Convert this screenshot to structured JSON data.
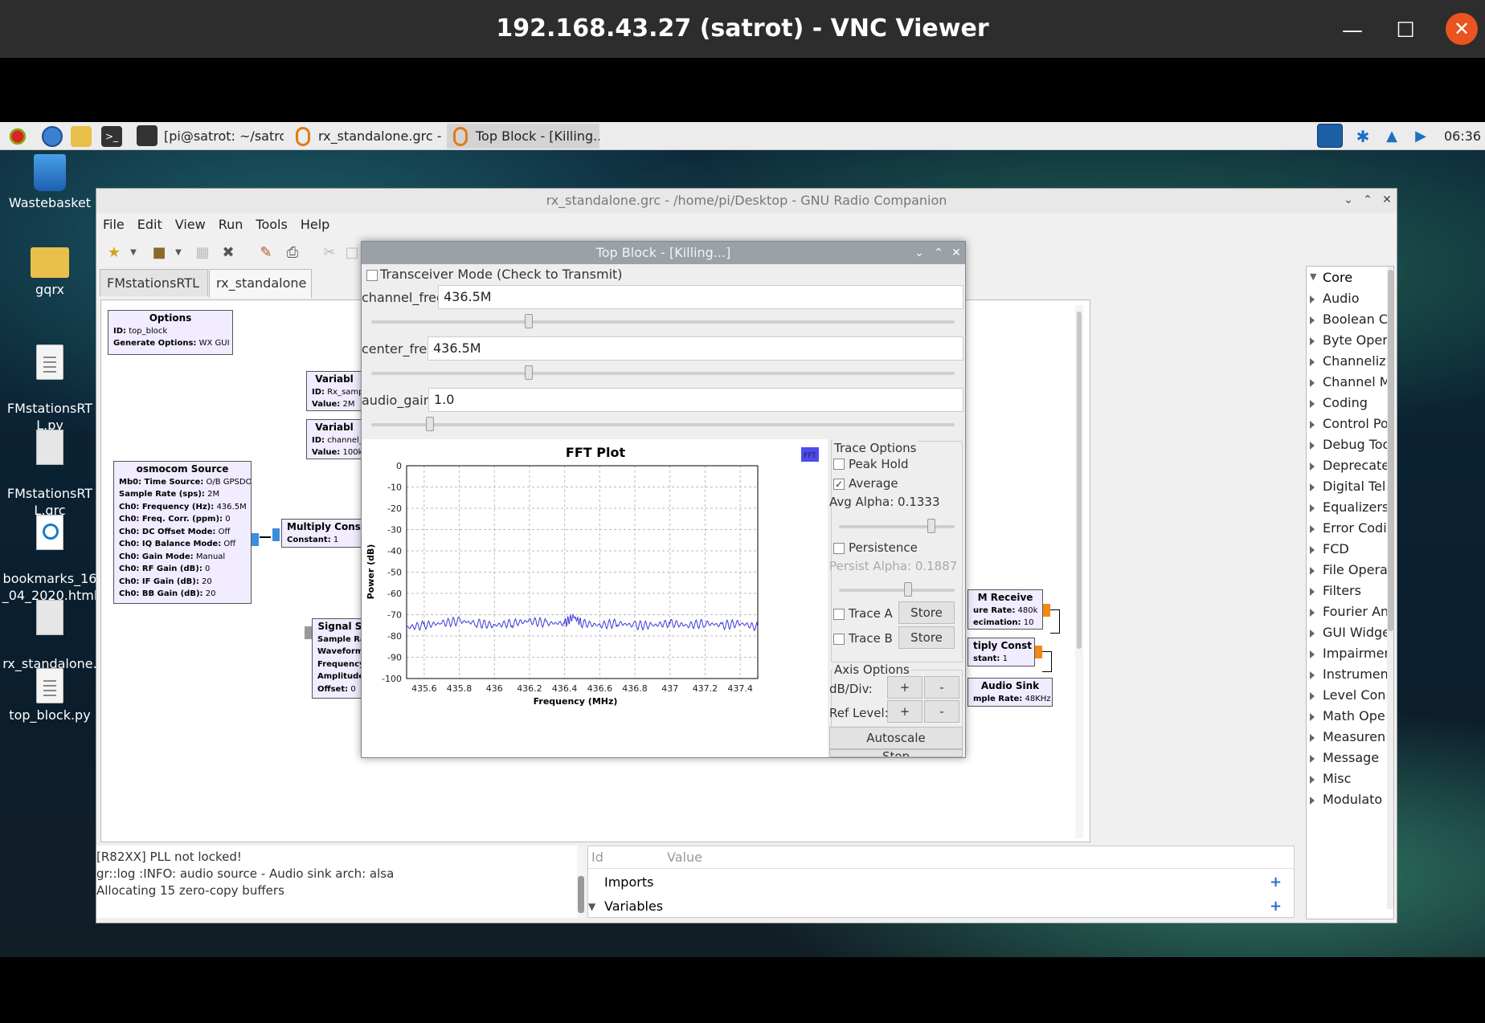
{
  "vnc": {
    "title": "192.168.43.27 (satrot) - VNC Viewer",
    "minimize": "—",
    "maximize": "☐",
    "close": "✕"
  },
  "taskbar": {
    "tasks": [
      "[pi@satrot: ~/satrot/...",
      "rx_standalone.grc - /h...",
      "Top Block - [Killing...]"
    ],
    "clock": "06:36"
  },
  "desktop": {
    "icons": [
      "Wastebasket",
      "gqrx",
      "FMstationsRT\nL.py",
      "FMstationsRT\nL.grc",
      "bookmarks_16\n_04_2020.html",
      "rx_standalone.\ngrc",
      "top_block.py"
    ]
  },
  "grc": {
    "title": "rx_standalone.grc - /home/pi/Desktop - GNU Radio Companion",
    "menu": [
      "File",
      "Edit",
      "View",
      "Run",
      "Tools",
      "Help"
    ],
    "tabs": [
      "FMstationsRTL",
      "rx_standalone"
    ],
    "tab_close": "✖",
    "blocks": {
      "options": {
        "title": "Options",
        "lines": [
          [
            "ID:",
            "top_block"
          ],
          [
            "Generate Options:",
            "WX GUI"
          ]
        ]
      },
      "var1": {
        "title": "Variabl",
        "lines": [
          [
            "ID:",
            "Rx_samp"
          ],
          [
            "Value:",
            "2M"
          ]
        ]
      },
      "var2": {
        "title": "Variabl",
        "lines": [
          [
            "ID:",
            "channel_"
          ],
          [
            "Value:",
            "100k"
          ]
        ]
      },
      "osmocom": {
        "title": "osmocom Source",
        "lines": [
          [
            "Mb0: Time Source:",
            "O/B GPSDO"
          ],
          [
            "Sample Rate (sps):",
            "2M"
          ],
          [
            "Ch0: Frequency (Hz):",
            "436.5M"
          ],
          [
            "Ch0: Freq. Corr. (ppm):",
            "0"
          ],
          [
            "Ch0: DC Offset Mode:",
            "Off"
          ],
          [
            "Ch0: IQ Balance Mode:",
            "Off"
          ],
          [
            "Ch0: Gain Mode:",
            "Manual"
          ],
          [
            "Ch0: RF Gain (dB):",
            "0"
          ],
          [
            "Ch0: IF Gain (dB):",
            "20"
          ],
          [
            "Ch0: BB Gain (dB):",
            "20"
          ]
        ]
      },
      "mult1": {
        "title": "Multiply Const",
        "lines": [
          [
            "Constant:",
            "1"
          ]
        ]
      },
      "signal": {
        "title": "Signal S",
        "lines": [
          [
            "Sample Ra",
            ""
          ],
          [
            "Waveform",
            ""
          ],
          [
            "Frequency",
            ""
          ],
          [
            "Amplitude",
            ""
          ],
          [
            "Offset:",
            "0"
          ]
        ]
      },
      "fm": {
        "title": "M Receive",
        "lines": [
          [
            "ure Rate:",
            "480k"
          ],
          [
            "ecimation:",
            "10"
          ]
        ]
      },
      "mult2": {
        "title": "tiply Const",
        "lines": [
          [
            "stant:",
            "1"
          ]
        ]
      },
      "audio": {
        "title": "Audio Sink",
        "lines": [
          [
            "mple Rate:",
            "48KHz"
          ]
        ]
      }
    },
    "console": [
      "[R82XX] PLL not locked!",
      "gr::log :INFO: audio source - Audio sink arch: alsa",
      "Allocating 15 zero-copy buffers"
    ],
    "vartable": {
      "col_id": "Id",
      "col_value": "Value",
      "rows": [
        "Imports",
        "Variables"
      ]
    },
    "blocklib": [
      "Core",
      "Audio",
      "Boolean C",
      "Byte Oper",
      "Channeliz",
      "Channel M",
      "Coding",
      "Control Po",
      "Debug Too",
      "Deprecate",
      "Digital Tel",
      "Equalizers",
      "Error Codi",
      "FCD",
      "File Opera",
      "Filters",
      "Fourier An",
      "GUI Widge",
      "Impairmen",
      "Instrumen",
      "Level Con",
      "Math Ope",
      "Measuren",
      "Message ",
      "Misc",
      "Modulato"
    ]
  },
  "topblock": {
    "title": "Top Block - [Killing...]",
    "transceiver": "Transceiver Mode (Check to Transmit)",
    "controls": [
      {
        "label": "channel_freq:",
        "value": "436.5M",
        "slider": 0.27
      },
      {
        "label": "center_freq:",
        "value": "436.5M",
        "slider": 0.27
      },
      {
        "label": "audio_gain:",
        "value": "1.0",
        "slider": 0.1
      }
    ],
    "trace": {
      "title": "Trace Options",
      "peak_hold": "Peak Hold",
      "average": "Average",
      "avg_alpha": "Avg Alpha: 0.1333",
      "avg_alpha_level": 0.8,
      "persistence": "Persistence",
      "persist_alpha": "Persist Alpha: 0.1887",
      "persist_alpha_level": 0.6,
      "trace_a": "Trace A",
      "trace_b": "Trace B",
      "store": "Store",
      "axis_title": "Axis Options",
      "db_div": "dB/Div:",
      "ref_level": "Ref Level:",
      "plus": "+",
      "minus": "-",
      "autoscale": "Autoscale",
      "stop": "Stop"
    }
  },
  "chart_data": {
    "type": "line",
    "title": "FFT Plot",
    "badge": "FFT",
    "xlabel": "Frequency (MHz)",
    "ylabel": "Power (dB)",
    "xlim": [
      435.5,
      437.5
    ],
    "ylim": [
      -100,
      0
    ],
    "xticks": [
      "435.6",
      "435.8",
      "436",
      "436.2",
      "436.4",
      "436.6",
      "436.8",
      "437",
      "437.2",
      "437.4"
    ],
    "xtick_values": [
      435.6,
      435.8,
      436.0,
      436.2,
      436.4,
      436.6,
      436.8,
      437.0,
      437.2,
      437.4
    ],
    "yticks": [
      "0",
      "-10",
      "-20",
      "-30",
      "-40",
      "-50",
      "-60",
      "-70",
      "-80",
      "-90",
      "-100"
    ],
    "ytick_values": [
      0,
      -10,
      -20,
      -30,
      -40,
      -50,
      -60,
      -70,
      -80,
      -90,
      -100
    ],
    "grid": true,
    "series_color": "#3a3ad8",
    "series": [
      {
        "x": [
          435.5,
          435.6,
          435.7,
          435.8,
          435.9,
          436.0,
          436.1,
          436.2,
          436.3,
          436.4,
          436.45,
          436.5,
          436.6,
          436.7,
          436.8,
          436.9,
          437.0,
          437.1,
          437.2,
          437.3,
          437.4,
          437.5
        ],
        "y": [
          -76,
          -75,
          -74,
          -73,
          -74,
          -75,
          -74,
          -73,
          -74,
          -74,
          -71,
          -74,
          -75,
          -74,
          -75,
          -75,
          -74,
          -75,
          -74,
          -75,
          -74,
          -76
        ]
      }
    ]
  }
}
